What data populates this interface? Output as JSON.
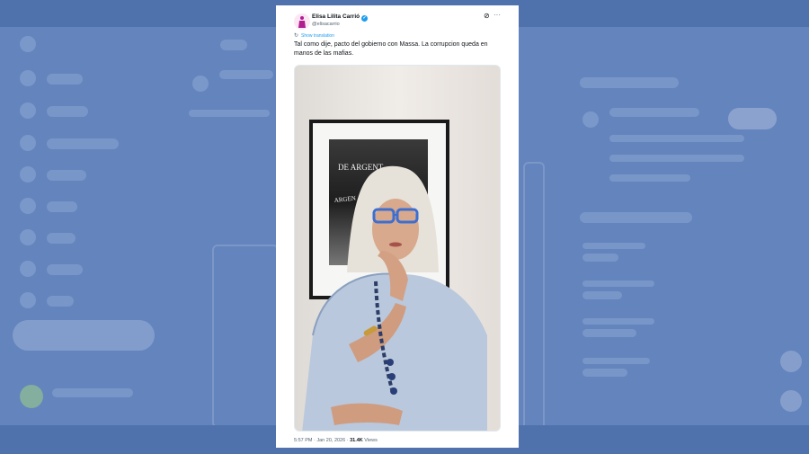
{
  "tweet": {
    "author_name": "Elisa Lilita Carrió",
    "author_handle": "@elisacarrio",
    "show_translation": "Show translation",
    "text": "Tal como dije, pacto del gobierno con Massa. La corrupcion queda en manos de las mafias.",
    "time": "5:57 PM · Jan 20, 2026 · ",
    "views_count": "31.4K",
    "views_label": " Views",
    "photo_poster_text_1": "DE ARGENT",
    "photo_poster_text_2": "ARGEN"
  },
  "icons": {
    "verified": "verified-badge-icon",
    "grok": "grok-icon",
    "more": "more-icon",
    "translate": "translate-icon"
  },
  "colors": {
    "background": "#6384bd",
    "link": "#1d9bf0",
    "text": "#0f1419",
    "muted": "#536471"
  }
}
